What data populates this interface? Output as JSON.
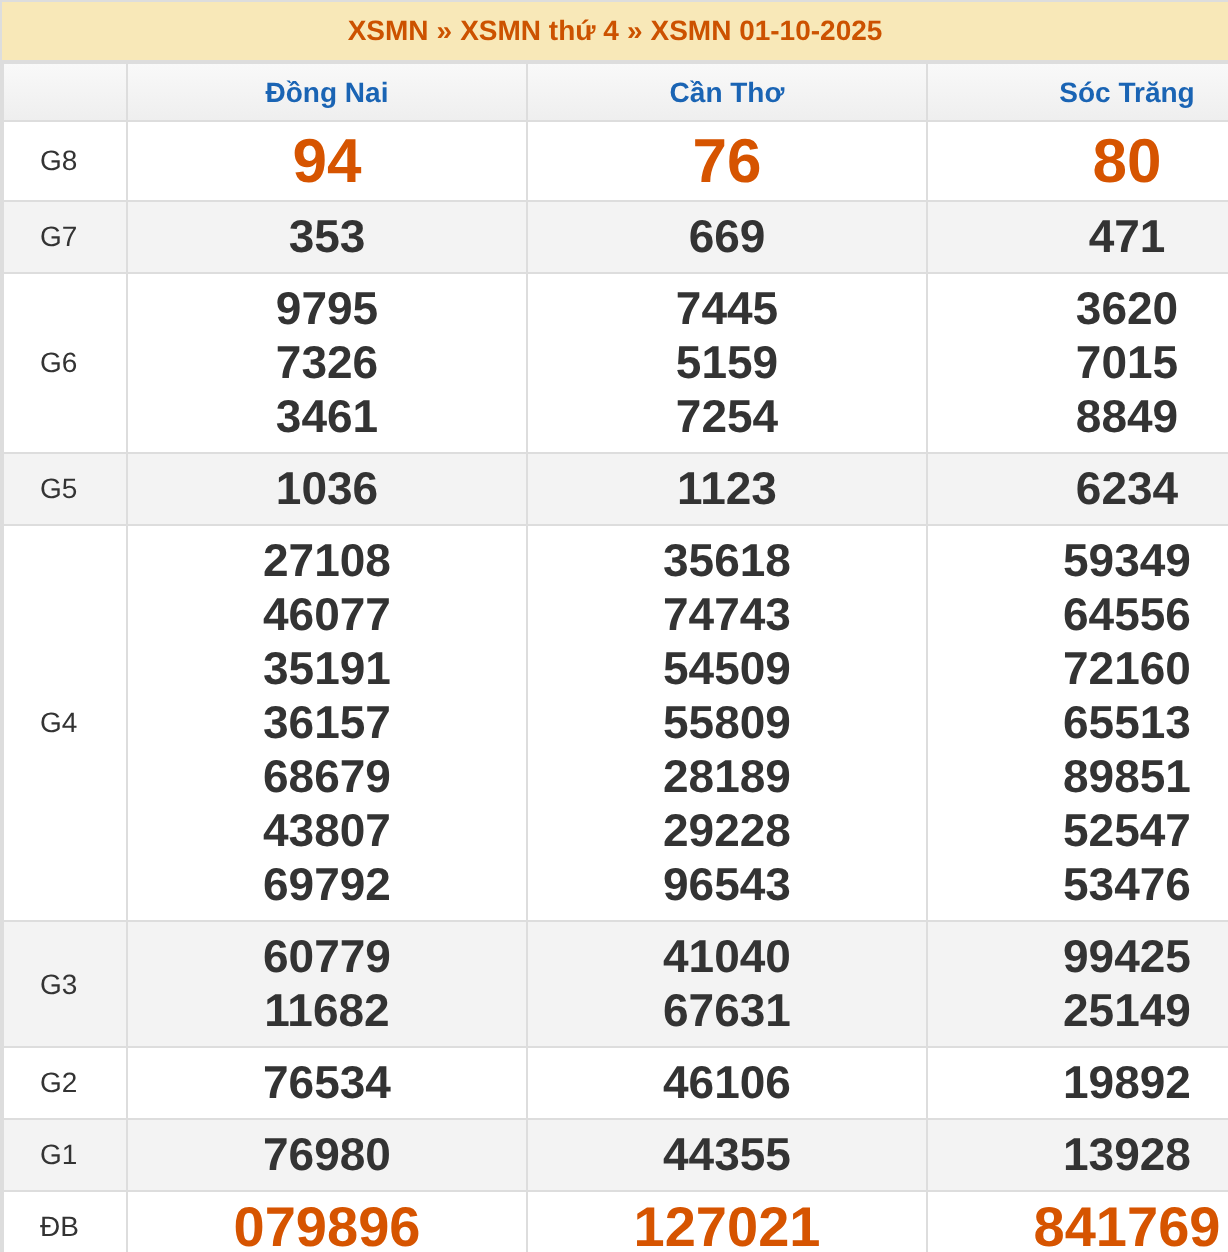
{
  "breadcrumb": [
    "XSMN",
    "XSMN thứ 4",
    "XSMN 01-10-2025"
  ],
  "breadcrumb_separator": "»",
  "table": {
    "columns": [
      "Đồng Nai",
      "Cần Thơ",
      "Sóc Trăng"
    ],
    "rows": [
      {
        "prize": "G8",
        "kind": "big",
        "values": [
          [
            "94"
          ],
          [
            "76"
          ],
          [
            "80"
          ]
        ]
      },
      {
        "prize": "G7",
        "kind": "normal",
        "values": [
          [
            "353"
          ],
          [
            "669"
          ],
          [
            "471"
          ]
        ]
      },
      {
        "prize": "G6",
        "kind": "normal",
        "values": [
          [
            "9795",
            "7326",
            "3461"
          ],
          [
            "7445",
            "5159",
            "7254"
          ],
          [
            "3620",
            "7015",
            "8849"
          ]
        ]
      },
      {
        "prize": "G5",
        "kind": "normal",
        "values": [
          [
            "1036"
          ],
          [
            "1123"
          ],
          [
            "6234"
          ]
        ]
      },
      {
        "prize": "G4",
        "kind": "normal",
        "values": [
          [
            "27108",
            "46077",
            "35191",
            "36157",
            "68679",
            "43807",
            "69792"
          ],
          [
            "35618",
            "74743",
            "54509",
            "55809",
            "28189",
            "29228",
            "96543"
          ],
          [
            "59349",
            "64556",
            "72160",
            "65513",
            "89851",
            "52547",
            "53476"
          ]
        ]
      },
      {
        "prize": "G3",
        "kind": "normal",
        "values": [
          [
            "60779",
            "11682"
          ],
          [
            "41040",
            "67631"
          ],
          [
            "99425",
            "25149"
          ]
        ]
      },
      {
        "prize": "G2",
        "kind": "normal",
        "values": [
          [
            "76534"
          ],
          [
            "46106"
          ],
          [
            "19892"
          ]
        ]
      },
      {
        "prize": "G1",
        "kind": "normal",
        "values": [
          [
            "76980"
          ],
          [
            "44355"
          ],
          [
            "13928"
          ]
        ]
      },
      {
        "prize": "ĐB",
        "kind": "special",
        "values": [
          [
            "079896"
          ],
          [
            "127021"
          ],
          [
            "841769"
          ]
        ]
      }
    ]
  }
}
